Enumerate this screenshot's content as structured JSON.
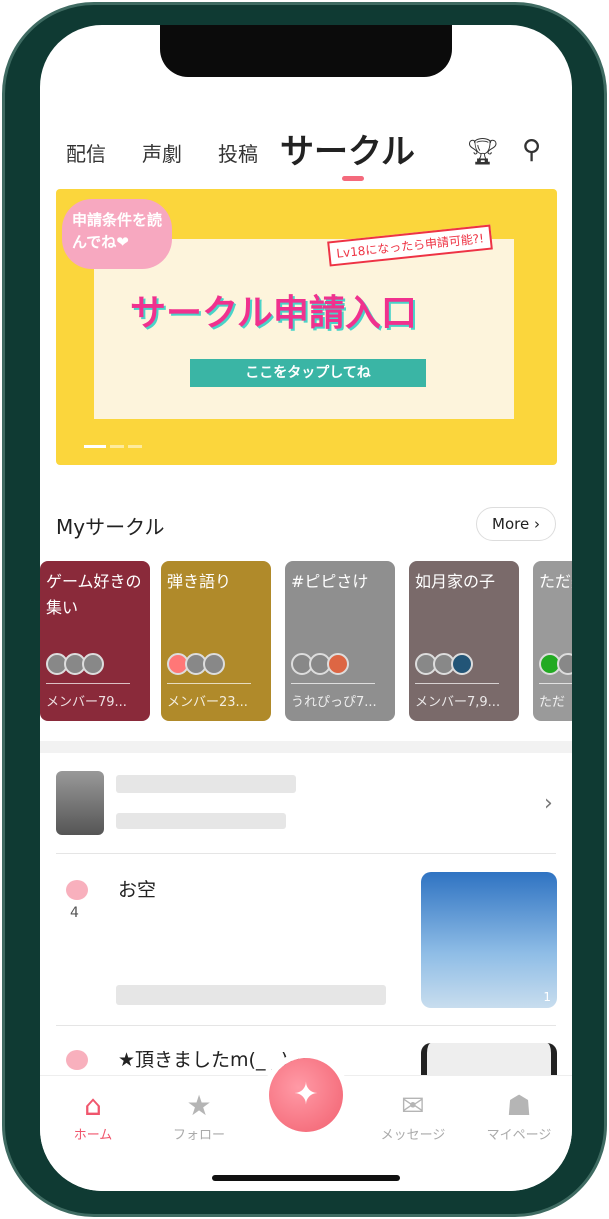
{
  "tabs": [
    {
      "label": "配信"
    },
    {
      "label": "声劇"
    },
    {
      "label": "投稿"
    },
    {
      "label": "サークル",
      "active": true
    }
  ],
  "header_icons": [
    "trophy-icon",
    "search-icon"
  ],
  "banner": {
    "bubble": "申請条件を読んでね❤",
    "tag": "Lv18になったら申請可能?!",
    "title": "サークル申請入口",
    "button": "ここをタップしてね"
  },
  "my_circle": {
    "title": "Myサークル",
    "more": "More ›",
    "cards": [
      {
        "title": "ゲーム好きの集い",
        "meta": "メンバー79...",
        "color": "#8a2a3a"
      },
      {
        "title": "弾き語り",
        "meta": "メンバー23...",
        "color": "#b08a2a"
      },
      {
        "title": "#ピピさけ",
        "meta": "うれぴっぴ7...",
        "color": "#8f8f8f"
      },
      {
        "title": "如月家の子",
        "meta": "メンバー7,9...",
        "color": "#7a6a6a"
      },
      {
        "title": "ただ楽部",
        "meta": "ただ",
        "color": "#9a9a9a"
      }
    ]
  },
  "posts": [
    {
      "title": "お空",
      "likes": "4",
      "images": "1"
    },
    {
      "title": "★頂きましたm(_ _)m"
    }
  ],
  "nav": {
    "items": [
      {
        "label": "ホーム",
        "icon": "home-icon",
        "active": true
      },
      {
        "label": "フォロー",
        "icon": "star-icon"
      },
      {
        "label": "メッセージ",
        "icon": "mail-icon"
      },
      {
        "label": "マイページ",
        "icon": "ghost-icon"
      }
    ]
  },
  "accent": "#f0566d"
}
